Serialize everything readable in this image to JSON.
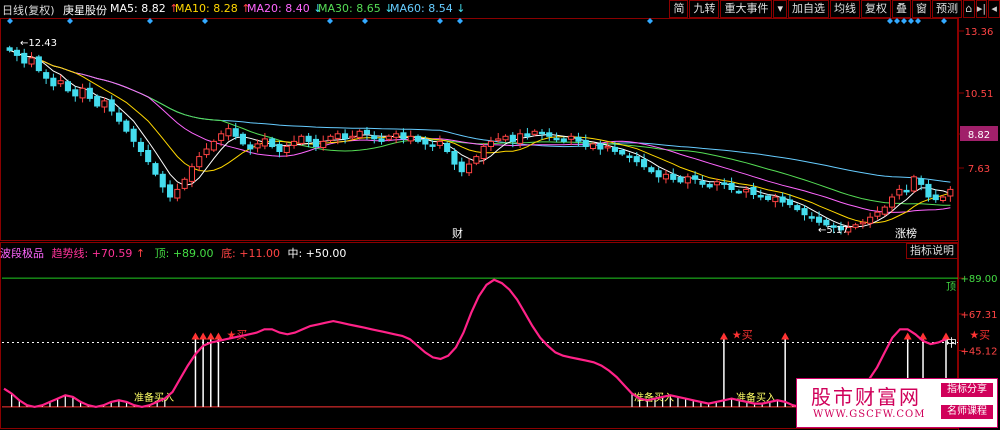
{
  "header": {
    "period": "日线(复权)",
    "stock_name": "庚星股份",
    "ma5": {
      "label": "MA5: 8.82",
      "arrow": "↑",
      "color": "#ffffff"
    },
    "ma10": {
      "label": "MA10: 8.28",
      "arrow": "↑",
      "color": "#ffd700"
    },
    "ma20": {
      "label": "MA20: 8.40",
      "arrow": "↓",
      "color": "#ff66ff"
    },
    "ma30": {
      "label": "MA30: 8.65",
      "arrow": "↓",
      "color": "#55dd55"
    },
    "ma60": {
      "label": "MA60: 8.54",
      "arrow": "↓",
      "color": "#66ccff"
    }
  },
  "toolbar": {
    "buttons": [
      "简",
      "九转",
      "重大事件",
      "▾",
      "加自选",
      "均线",
      "复权",
      "叠",
      "窗",
      "预测"
    ],
    "right": [
      "⌂",
      "▸|",
      "◂"
    ]
  },
  "price_axis": {
    "labels": [
      "13.36",
      "10.51",
      "8.82",
      "7.63",
      "5.17",
      "12.43"
    ],
    "current_price": "8.82"
  },
  "chart_labels": {
    "high_marker": "12.43",
    "low_marker": "5.17",
    "caibao": "财",
    "zhangbang": "涨榜"
  },
  "indicator": {
    "name": "波段极品",
    "trend_label": "趋势线: +70.59",
    "trend_arrow": "↑",
    "top_label": "顶: +89.00",
    "bottom_label": "底: +11.00",
    "mid_label": "中: +50.00",
    "explain_button": "指标说明",
    "axis_labels": [
      "+89.00",
      "+67.31",
      "+45.12"
    ],
    "top_tag": "顶",
    "mid_tag": "中",
    "buy_label": "买",
    "prepare_buy_label": "准备买入"
  },
  "watermark": {
    "title": "股市财富网",
    "url": "WWW.GSCFW.COM",
    "tag1": "指标分享",
    "tag2": "名师课程"
  },
  "chart_data": {
    "type": "candlestick",
    "ma_colors": {
      "ma5": "#ffffff",
      "ma10": "#ffd700",
      "ma20": "#ff66ff",
      "ma30": "#55dd55",
      "ma60": "#66ccff"
    },
    "up_color": "#ff4444",
    "down_color": "#44ddee",
    "price_ylim": [
      4.9,
      13.6
    ],
    "close": [
      12.4,
      12.2,
      11.9,
      12.1,
      11.6,
      11.3,
      11.0,
      11.2,
      10.8,
      10.6,
      10.9,
      10.5,
      10.2,
      10.4,
      10.0,
      9.6,
      9.2,
      8.8,
      8.4,
      8.0,
      7.5,
      7.0,
      6.6,
      6.9,
      7.3,
      7.8,
      8.2,
      8.5,
      8.8,
      9.1,
      9.3,
      9.0,
      8.7,
      8.5,
      8.7,
      8.9,
      8.6,
      8.4,
      8.6,
      8.8,
      9.0,
      8.8,
      8.6,
      8.8,
      9.0,
      9.1,
      8.9,
      9.0,
      9.2,
      9.1,
      8.9,
      8.8,
      9.0,
      9.1,
      8.9,
      9.0,
      8.8,
      8.7,
      8.6,
      8.8,
      8.4,
      7.9,
      7.6,
      7.9,
      8.2,
      8.6,
      8.8,
      8.9,
      9.0,
      8.8,
      9.1,
      9.0,
      9.2,
      9.1,
      9.0,
      8.9,
      8.8,
      9.0,
      8.8,
      8.6,
      8.7,
      8.5,
      8.6,
      8.4,
      8.3,
      8.2,
      8.0,
      7.8,
      7.6,
      7.4,
      7.5,
      7.3,
      7.2,
      7.4,
      7.3,
      7.1,
      7.0,
      7.2,
      7.1,
      6.9,
      6.8,
      6.9,
      6.7,
      6.6,
      6.5,
      6.6,
      6.4,
      6.3,
      6.1,
      5.9,
      5.8,
      5.6,
      5.5,
      5.4,
      5.3,
      5.4,
      5.5,
      5.6,
      5.8,
      6.0,
      6.2,
      6.6,
      6.9,
      6.8,
      7.4,
      7.1,
      6.6,
      6.5,
      6.6,
      6.9
    ],
    "indicator_ylim": [
      0,
      100
    ],
    "trend": [
      22,
      19,
      15,
      12,
      11,
      12,
      14,
      16,
      18,
      17,
      14,
      12,
      11,
      12,
      14,
      15,
      14,
      12,
      11,
      12,
      14,
      16,
      20,
      28,
      36,
      43,
      48,
      50,
      51,
      52,
      53,
      54,
      55,
      56,
      58,
      58,
      56,
      55,
      56,
      58,
      60,
      61,
      62,
      63,
      62,
      61,
      60,
      59,
      58,
      57,
      56,
      55,
      54,
      52,
      48,
      44,
      41,
      40,
      42,
      47,
      56,
      68,
      78,
      85,
      88,
      86,
      82,
      76,
      68,
      60,
      53,
      48,
      44,
      42,
      41,
      40,
      39,
      38,
      36,
      33,
      29,
      24,
      19,
      16,
      15,
      16,
      17,
      18,
      17,
      16,
      15,
      14,
      13,
      14,
      15,
      16,
      15,
      14,
      13,
      13,
      14,
      15,
      14,
      12,
      11,
      10,
      9,
      10,
      12,
      14,
      16,
      18,
      22,
      28,
      35,
      44,
      53,
      58,
      58,
      55,
      51,
      49,
      50,
      52
    ]
  }
}
